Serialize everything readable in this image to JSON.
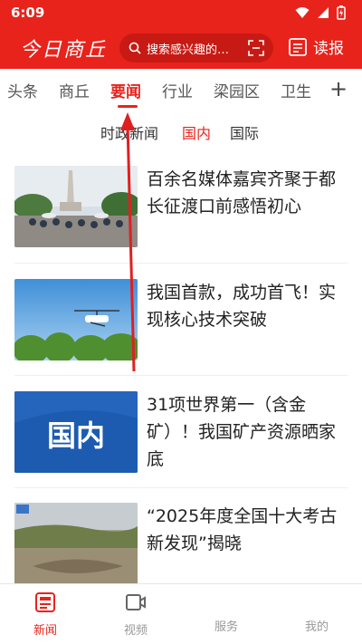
{
  "status_bar": {
    "time": "6:09"
  },
  "header": {
    "logo_text": "今日商丘",
    "search_placeholder": "搜索感兴趣的…",
    "read_label": "读报"
  },
  "channels": [
    "头条",
    "商丘",
    "要闻",
    "行业",
    "梁园区",
    "卫生"
  ],
  "active_channel": "要闻",
  "subtabs": [
    "时政新闻",
    "国内",
    "国际"
  ],
  "active_subtab": "国内",
  "news": [
    {
      "title": "百余名媒体嘉宾齐聚于都长征渡口前感悟初心",
      "thumb": "monument-crowd-photo"
    },
    {
      "title": "我国首款，成功首飞！实现核心技术突破",
      "thumb": "helicopter-photo"
    },
    {
      "title": "31项世界第一（含金矿）！我国矿产资源晒家底",
      "thumb": "guonei-banner",
      "thumb_text": "国内"
    },
    {
      "title": "“2025年度全国十大考古新发现”揭晓",
      "thumb": "excavation-site-photo"
    }
  ],
  "bottom_nav": [
    {
      "label": "新闻",
      "icon": "news-icon",
      "active": true
    },
    {
      "label": "视频",
      "icon": "video-icon",
      "active": false
    },
    {
      "label": "服务",
      "icon": "service-icon",
      "active": false
    },
    {
      "label": "我的",
      "icon": "profile-icon",
      "active": false
    }
  ],
  "colors": {
    "brand_red": "#e8231c",
    "annotation_arrow": "#e02020"
  }
}
